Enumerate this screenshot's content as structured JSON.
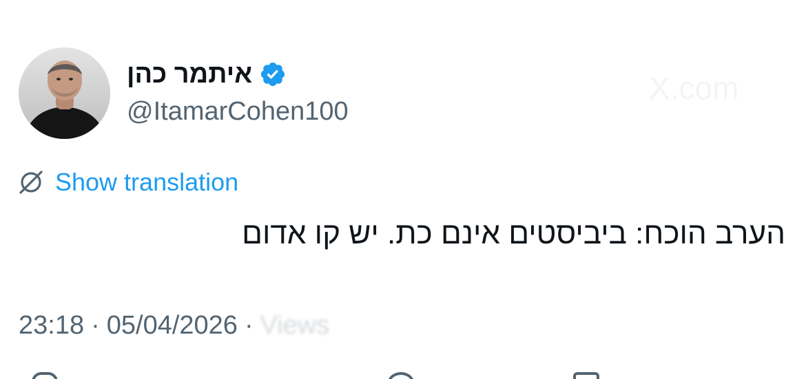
{
  "author": {
    "display_name": "איתמר כהן",
    "handle": "@ItamarCohen100",
    "verified_icon": "verified-badge-icon",
    "verified_color": "#1d9bf0"
  },
  "watermark_text": "X.com",
  "translation": {
    "label": "Show translation",
    "icon": "translate-globe-icon",
    "color": "#1d9bf0"
  },
  "tweet": {
    "text": "הערב הוכח: ביביסטים אינם כת. יש קו אדום"
  },
  "meta": {
    "time": "23:18",
    "separator": "·",
    "date": "05/04/2026",
    "views_label": "Views",
    "text_color": "#536471"
  },
  "action_bar": {
    "icons": [
      "reply-icon",
      "like-icon",
      "bookmark-icon"
    ]
  }
}
